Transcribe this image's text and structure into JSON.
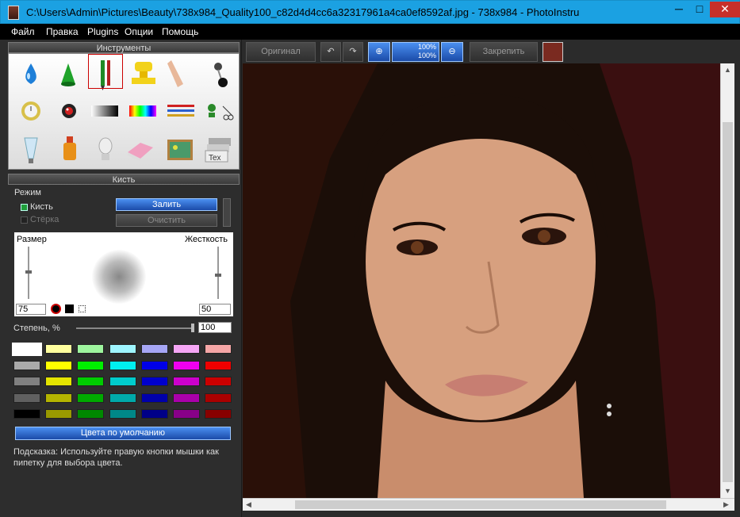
{
  "window": {
    "title": "C:\\Users\\Admin\\Pictures\\Beauty\\738x984_Quality100_c82d4d4cc6a32317961a4ca0ef8592af.jpg - 738x984 - PhotoInstru",
    "minimize_glyph": "─",
    "maximize_glyph": "□",
    "close_glyph": "✕"
  },
  "menu": {
    "items": [
      "Файл",
      "Правка",
      "Plugins",
      "Опции",
      "Помощь"
    ]
  },
  "tools_panel": {
    "title": "Инструменты",
    "tools": [
      "blur-drop-tool",
      "sharpen-cone-tool",
      "brush-pencil-tool",
      "stamp-tool",
      "smudge-finger-tool",
      "pin-tool",
      "wrinkle-clock-tool",
      "red-eye-tool",
      "gradient-tool",
      "color-spectrum-tool",
      "lines-tool",
      "clone-scissors-tool",
      "tube-tool",
      "perfume-tool",
      "lamp-tool",
      "eraser-tool",
      "picture-tool",
      "text-tool"
    ]
  },
  "brush_panel": {
    "title": "Кисть",
    "mode_label": "Режим",
    "mode_brush": "Кисть",
    "mode_eraser": "Стёрка",
    "fill_button": "Залить",
    "clear_button": "Очистить",
    "size_label": "Размер",
    "hardness_label": "Жесткость",
    "size_value": "75",
    "hardness_value": "50",
    "degree_label": "Степень, %",
    "degree_value": "100",
    "defaults_button": "Цвета по умолчанию",
    "hint": "Подсказка: Используйте правую кнопки мышки как пипетку для выбора цвета."
  },
  "palette": {
    "rows": [
      [
        "#ffffff",
        "#ffff9e",
        "#9ef59e",
        "#9ef5ff",
        "#a6a6f5",
        "#f5a6f5",
        "#f5a6a6"
      ],
      [
        "#aaaaaa",
        "#ffff00",
        "#00f000",
        "#00f0f0",
        "#0000e8",
        "#f000f0",
        "#f00000"
      ],
      [
        "#808080",
        "#e4e400",
        "#00cc00",
        "#00cccc",
        "#0000cc",
        "#cc00cc",
        "#cc0000"
      ],
      [
        "#606060",
        "#b4b400",
        "#00aa00",
        "#00aaaa",
        "#0000aa",
        "#aa00aa",
        "#aa0000"
      ],
      [
        "#000000",
        "#9a9a00",
        "#008800",
        "#008888",
        "#000088",
        "#880088",
        "#880000"
      ]
    ],
    "selected_row": 0,
    "selected_col": 0
  },
  "toolbar": {
    "original": "Оригинал",
    "apply": "Закрепить",
    "zoom_top": "100%",
    "zoom_bottom": "100%"
  },
  "colors": {
    "titlebar": "#1ba1e2",
    "close": "#c7302a",
    "accent_blue": "#2a6ad0"
  }
}
